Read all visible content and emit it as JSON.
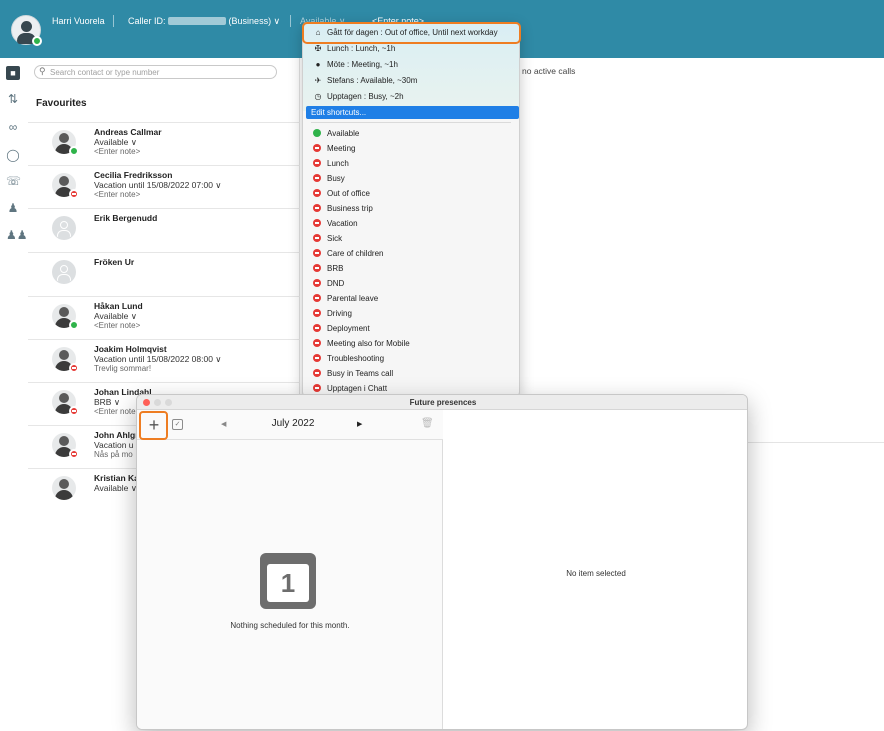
{
  "header": {
    "user_name": "Harri Vuorela",
    "caller_id_label": "Caller ID:",
    "caller_id_suffix": "(Business) ∨",
    "presence": "Available ∨",
    "note": "<Enter note>"
  },
  "search": {
    "placeholder": "Search contact or type number"
  },
  "favourites": {
    "title": "Favourites",
    "contacts": [
      {
        "name": "Andreas Callmar",
        "status": "Available ∨",
        "note": "<Enter note>",
        "presence": "green"
      },
      {
        "name": "Cecilia Fredriksson",
        "status": "Vacation until 15/08/2022 07:00 ∨",
        "note": "<Enter note>",
        "presence": "red"
      },
      {
        "name": "Erik Bergenudd",
        "status": "",
        "note": "",
        "presence": "none"
      },
      {
        "name": "Fröken Ur",
        "status": "",
        "note": "",
        "presence": "none"
      },
      {
        "name": "Håkan Lund",
        "status": "Available ∨",
        "note": "<Enter note>",
        "presence": "green"
      },
      {
        "name": "Joakim Holmqvist",
        "status": "Vacation until 15/08/2022 08:00 ∨",
        "note": "Trevlig sommar!",
        "presence": "red"
      },
      {
        "name": "Johan Lindahl",
        "status": "BRB ∨",
        "note": "<Enter note>",
        "presence": "red"
      },
      {
        "name": "John Ahlgr",
        "status": "Vacation u",
        "note": "Nås på mo",
        "presence": "red"
      },
      {
        "name": "Kristian Ka",
        "status": "Available ∨",
        "note": "",
        "presence": "green"
      }
    ]
  },
  "calls": {
    "empty": "no active calls"
  },
  "presence_menu": {
    "shortcuts": [
      {
        "icon": "home-icon",
        "glyph": "⌂",
        "label": "Gått för dagen : Out of office, Until next workday"
      },
      {
        "icon": "cutlery-icon",
        "glyph": "✠",
        "label": "Lunch : Lunch, ~1h"
      },
      {
        "icon": "meeting-icon",
        "glyph": "●",
        "label": "Möte : Meeting, ~1h"
      },
      {
        "icon": "plane-icon",
        "glyph": "✈",
        "label": "Stefans : Available, ~30m"
      },
      {
        "icon": "clock-icon",
        "glyph": "◷",
        "label": "Upptagen : Busy, ~2h"
      }
    ],
    "edit_shortcuts": "Edit shortcuts...",
    "statuses": [
      {
        "label": "Available",
        "color": "green"
      },
      {
        "label": "Meeting",
        "color": "red"
      },
      {
        "label": "Lunch",
        "color": "red"
      },
      {
        "label": "Busy",
        "color": "red"
      },
      {
        "label": "Out of office",
        "color": "red"
      },
      {
        "label": "Business trip",
        "color": "red"
      },
      {
        "label": "Vacation",
        "color": "red"
      },
      {
        "label": "Sick",
        "color": "red"
      },
      {
        "label": "Care of children",
        "color": "red"
      },
      {
        "label": "BRB",
        "color": "red"
      },
      {
        "label": "DND",
        "color": "red"
      },
      {
        "label": "Parental leave",
        "color": "red"
      },
      {
        "label": "Driving",
        "color": "red"
      },
      {
        "label": "Deployment",
        "color": "red"
      },
      {
        "label": "Meeting also for Mobile",
        "color": "red"
      },
      {
        "label": "Troubleshooting",
        "color": "red"
      },
      {
        "label": "Busy in Teams call",
        "color": "red"
      },
      {
        "label": "Upptagen i Chatt",
        "color": "red"
      }
    ]
  },
  "future_presences": {
    "title": "Future presences",
    "add": "+",
    "month": "July 2022",
    "prev": "◀",
    "next": "▶",
    "calendar_day": "1",
    "empty_left": "Nothing scheduled for this month.",
    "empty_right": "No item selected"
  },
  "colors": {
    "header": "#2f8aa6",
    "accent": "#1f7fe6",
    "highlight": "#ee7d22",
    "available": "#2fb34a",
    "busy": "#e53935"
  }
}
